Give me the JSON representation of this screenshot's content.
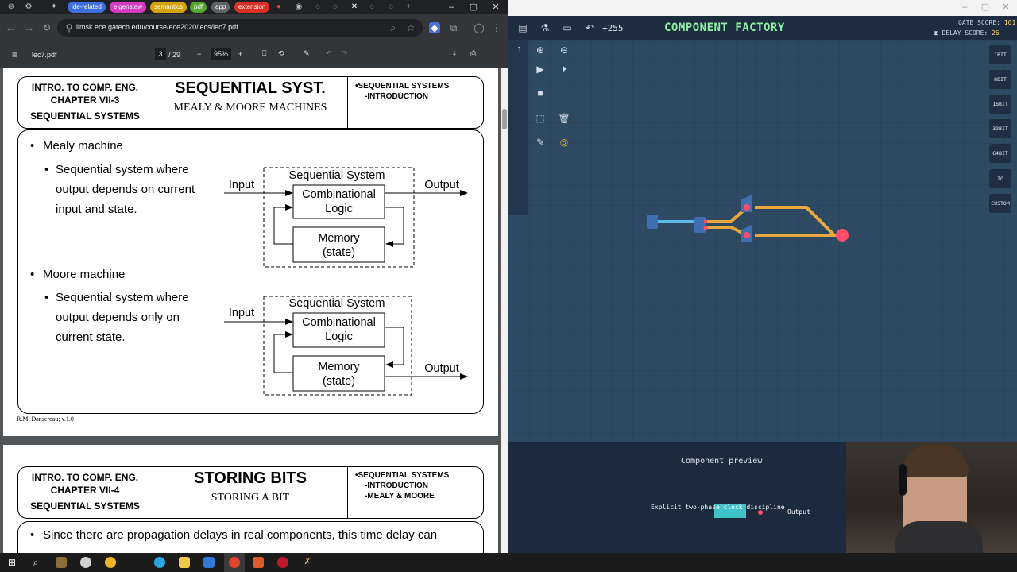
{
  "browser": {
    "tab_pills": [
      {
        "label": "ide-related",
        "color": "#3d6fe0"
      },
      {
        "label": "eigenstew",
        "color": "#d43cc0"
      },
      {
        "label": "semantics",
        "color": "#d4a20a"
      },
      {
        "label": "pdf",
        "color": "#55a630"
      },
      {
        "label": "app",
        "color": "#5f6368"
      },
      {
        "label": "extension",
        "color": "#d93025"
      }
    ],
    "url": "limsk.ece.gatech.edu/course/ece2020/lecs/lec7.pdf",
    "pdf_toolbar": {
      "file_name": "lec7.pdf",
      "page_current": "3",
      "page_total": "/ 29",
      "zoom": "95%",
      "zoom_out": "−",
      "zoom_in": "+"
    }
  },
  "slide1": {
    "header_left": [
      "INTRO. TO COMP. ENG.",
      "CHAPTER VII-3",
      "SEQUENTIAL SYSTEMS"
    ],
    "title": "SEQUENTIAL SYST.",
    "subtitle": "MEALY & MOORE MACHINES",
    "header_right": [
      "•SEQUENTIAL SYSTEMS",
      "-INTRODUCTION"
    ],
    "mealy_bullet": "Mealy machine",
    "mealy_desc": [
      "Sequential system where",
      "output depends on current",
      "input and state."
    ],
    "moore_bullet": "Moore machine",
    "moore_desc": [
      "Sequential system where",
      "output depends only on",
      "current state."
    ],
    "diagram": {
      "system_label": "Sequential System",
      "input_label": "Input",
      "output_label": "Output",
      "logic_label": [
        "Combinational",
        "Logic"
      ],
      "memory_label": [
        "Memory",
        "(state)"
      ]
    },
    "footer": "R.M. Dansereau; v.1.0"
  },
  "slide2": {
    "header_left": [
      "INTRO. TO COMP. ENG.",
      "CHAPTER VII-4",
      "SEQUENTIAL SYSTEMS"
    ],
    "title": "STORING BITS",
    "subtitle": "STORING A BIT",
    "header_right": [
      "•SEQUENTIAL SYSTEMS",
      "-INTRODUCTION",
      "-MEALY & MOORE"
    ],
    "body": "Since there are propagation delays in real components, this time delay can"
  },
  "game": {
    "title": "COMPONENT FACTORY",
    "gate_count": "+255",
    "gate_score_label": "GATE SCORE:",
    "gate_score": "101",
    "delay_score_label": "DELAY SCORE:",
    "delay_score": "26",
    "left_tools_label": "1",
    "bit_buttons": [
      "1BIT",
      "8BIT",
      "16BIT",
      "32BIT",
      "64BIT",
      "IO",
      "CUSTOM"
    ],
    "preview_title": "Component preview",
    "preview_label": "Explicit two-phase clock discipline",
    "preview_output": "Output",
    "wire_color": "#e9a93e",
    "input_wire_color": "#5bb8e8",
    "pin_color": "#ff4d6a"
  }
}
